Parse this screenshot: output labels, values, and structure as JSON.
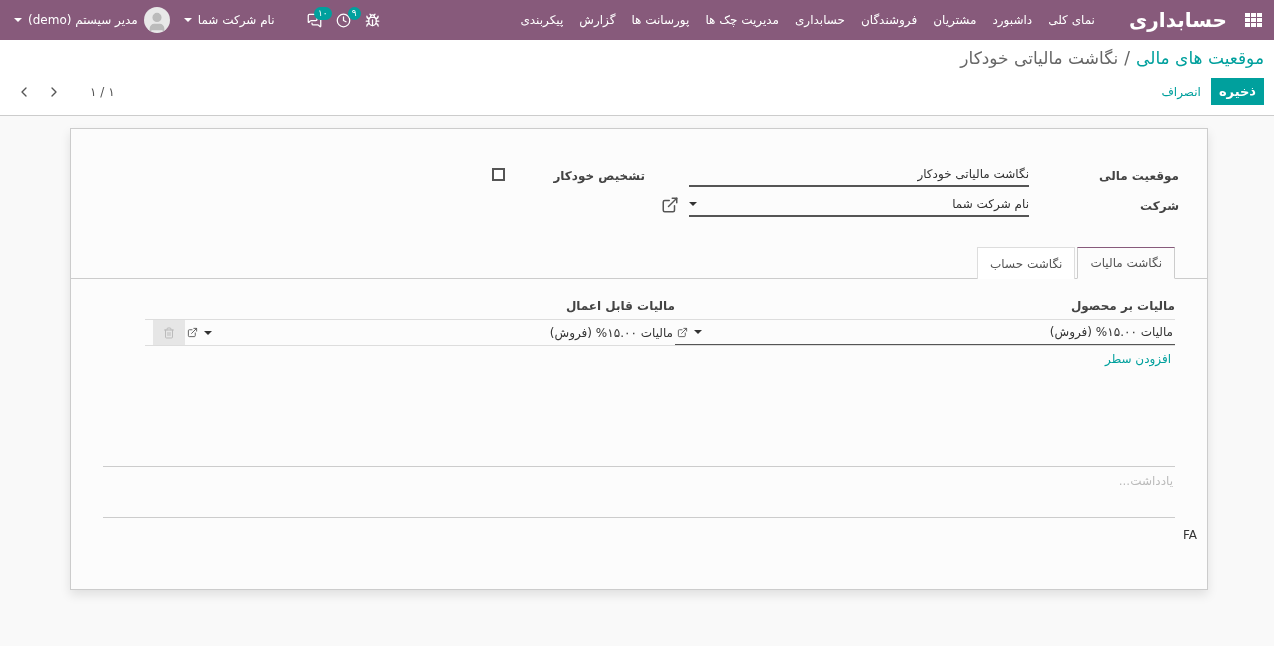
{
  "navbar": {
    "app_title": "حسابداری",
    "menu": [
      "نمای کلی",
      "داشبورد",
      "مشتریان",
      "فروشندگان",
      "حسابداری",
      "مدیریت چک ها",
      "پورسانت ها",
      "گزارش",
      "پیکربندی"
    ],
    "notifications": [
      {
        "kind": "activity",
        "count": "۹"
      },
      {
        "kind": "chat",
        "count": "۱۰"
      }
    ],
    "company": "نام شرکت شما",
    "user": "مدیر سیستم (demo)"
  },
  "breadcrumb": {
    "parent": "موقعیت های مالی",
    "separator": "/",
    "current": "نگاشت مالیاتی خودکار"
  },
  "buttons": {
    "save": "ذخیره",
    "cancel": "انصراف"
  },
  "pager": "۱ / ۱",
  "form": {
    "name": {
      "label": "موقعیت مالی",
      "value": "نگاشت مالیاتی خودکار"
    },
    "company": {
      "label": "شرکت",
      "value": "نام شرکت شما"
    },
    "auto_detect": {
      "label": "تشخیص خودکار",
      "checked": false
    }
  },
  "tabs": [
    {
      "label": "نگاشت مالیات",
      "selected": true
    },
    {
      "label": "نگاشت حساب",
      "selected": false
    }
  ],
  "table": {
    "columns": [
      "مالیات بر محصول",
      "مالیات قابل اعمال"
    ],
    "rows": [
      {
        "tax_src": "مالیات ۱۵.۰۰% (فروش)",
        "tax_dest": "مالیات ۱۵.۰۰% (فروش)"
      }
    ],
    "add_line": "افزودن سطر"
  },
  "notes": {
    "placeholder": "یادداشت..."
  },
  "footer": "FA"
}
